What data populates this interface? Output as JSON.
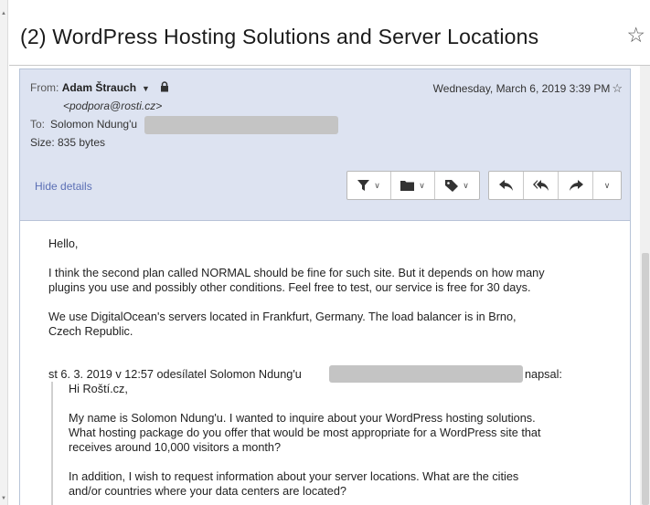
{
  "subject": "(2) WordPress Hosting Solutions and Server Locations",
  "header": {
    "from_label": "From:",
    "from_name": "Adam Štrauch",
    "from_email": "<podpora@rosti.cz>",
    "date": "Wednesday, March 6, 2019 3:39 PM",
    "to_label": "To:",
    "to_name": "Solomon Ndung'u",
    "size_text": "Size: 835 bytes",
    "hide_details": "Hide details"
  },
  "body": {
    "greeting": "Hello,",
    "para1_line1": "I think the second plan called NORMAL should be fine for such site. But it depends on how many",
    "para1_line2": "plugins you use and possibly other conditions. Feel free to test, our service is free for 30 days.",
    "para2_line1": "We use DigitalOcean's servers located in Frankfurt, Germany. The load balancer is in Brno,",
    "para2_line2": "Czech Republic.",
    "quote_head": "st 6. 3. 2019 v 12:57 odesílatel Solomon Ndung'u",
    "quote_head_tail": "napsal:",
    "quote": {
      "greeting": "Hi Roští.cz,",
      "para1_line1": "My name is Solomon Ndung'u. I wanted to inquire about your WordPress hosting solutions.",
      "para1_line2": "What hosting package do you offer that would be most appropriate for a WordPress site that",
      "para1_line3": "receives around 10,000 visitors a month?",
      "para2_line1": "In addition, I wish to request information about your server locations. What are the cities",
      "para2_line2": "and/or countries where your data centers are located?"
    }
  }
}
